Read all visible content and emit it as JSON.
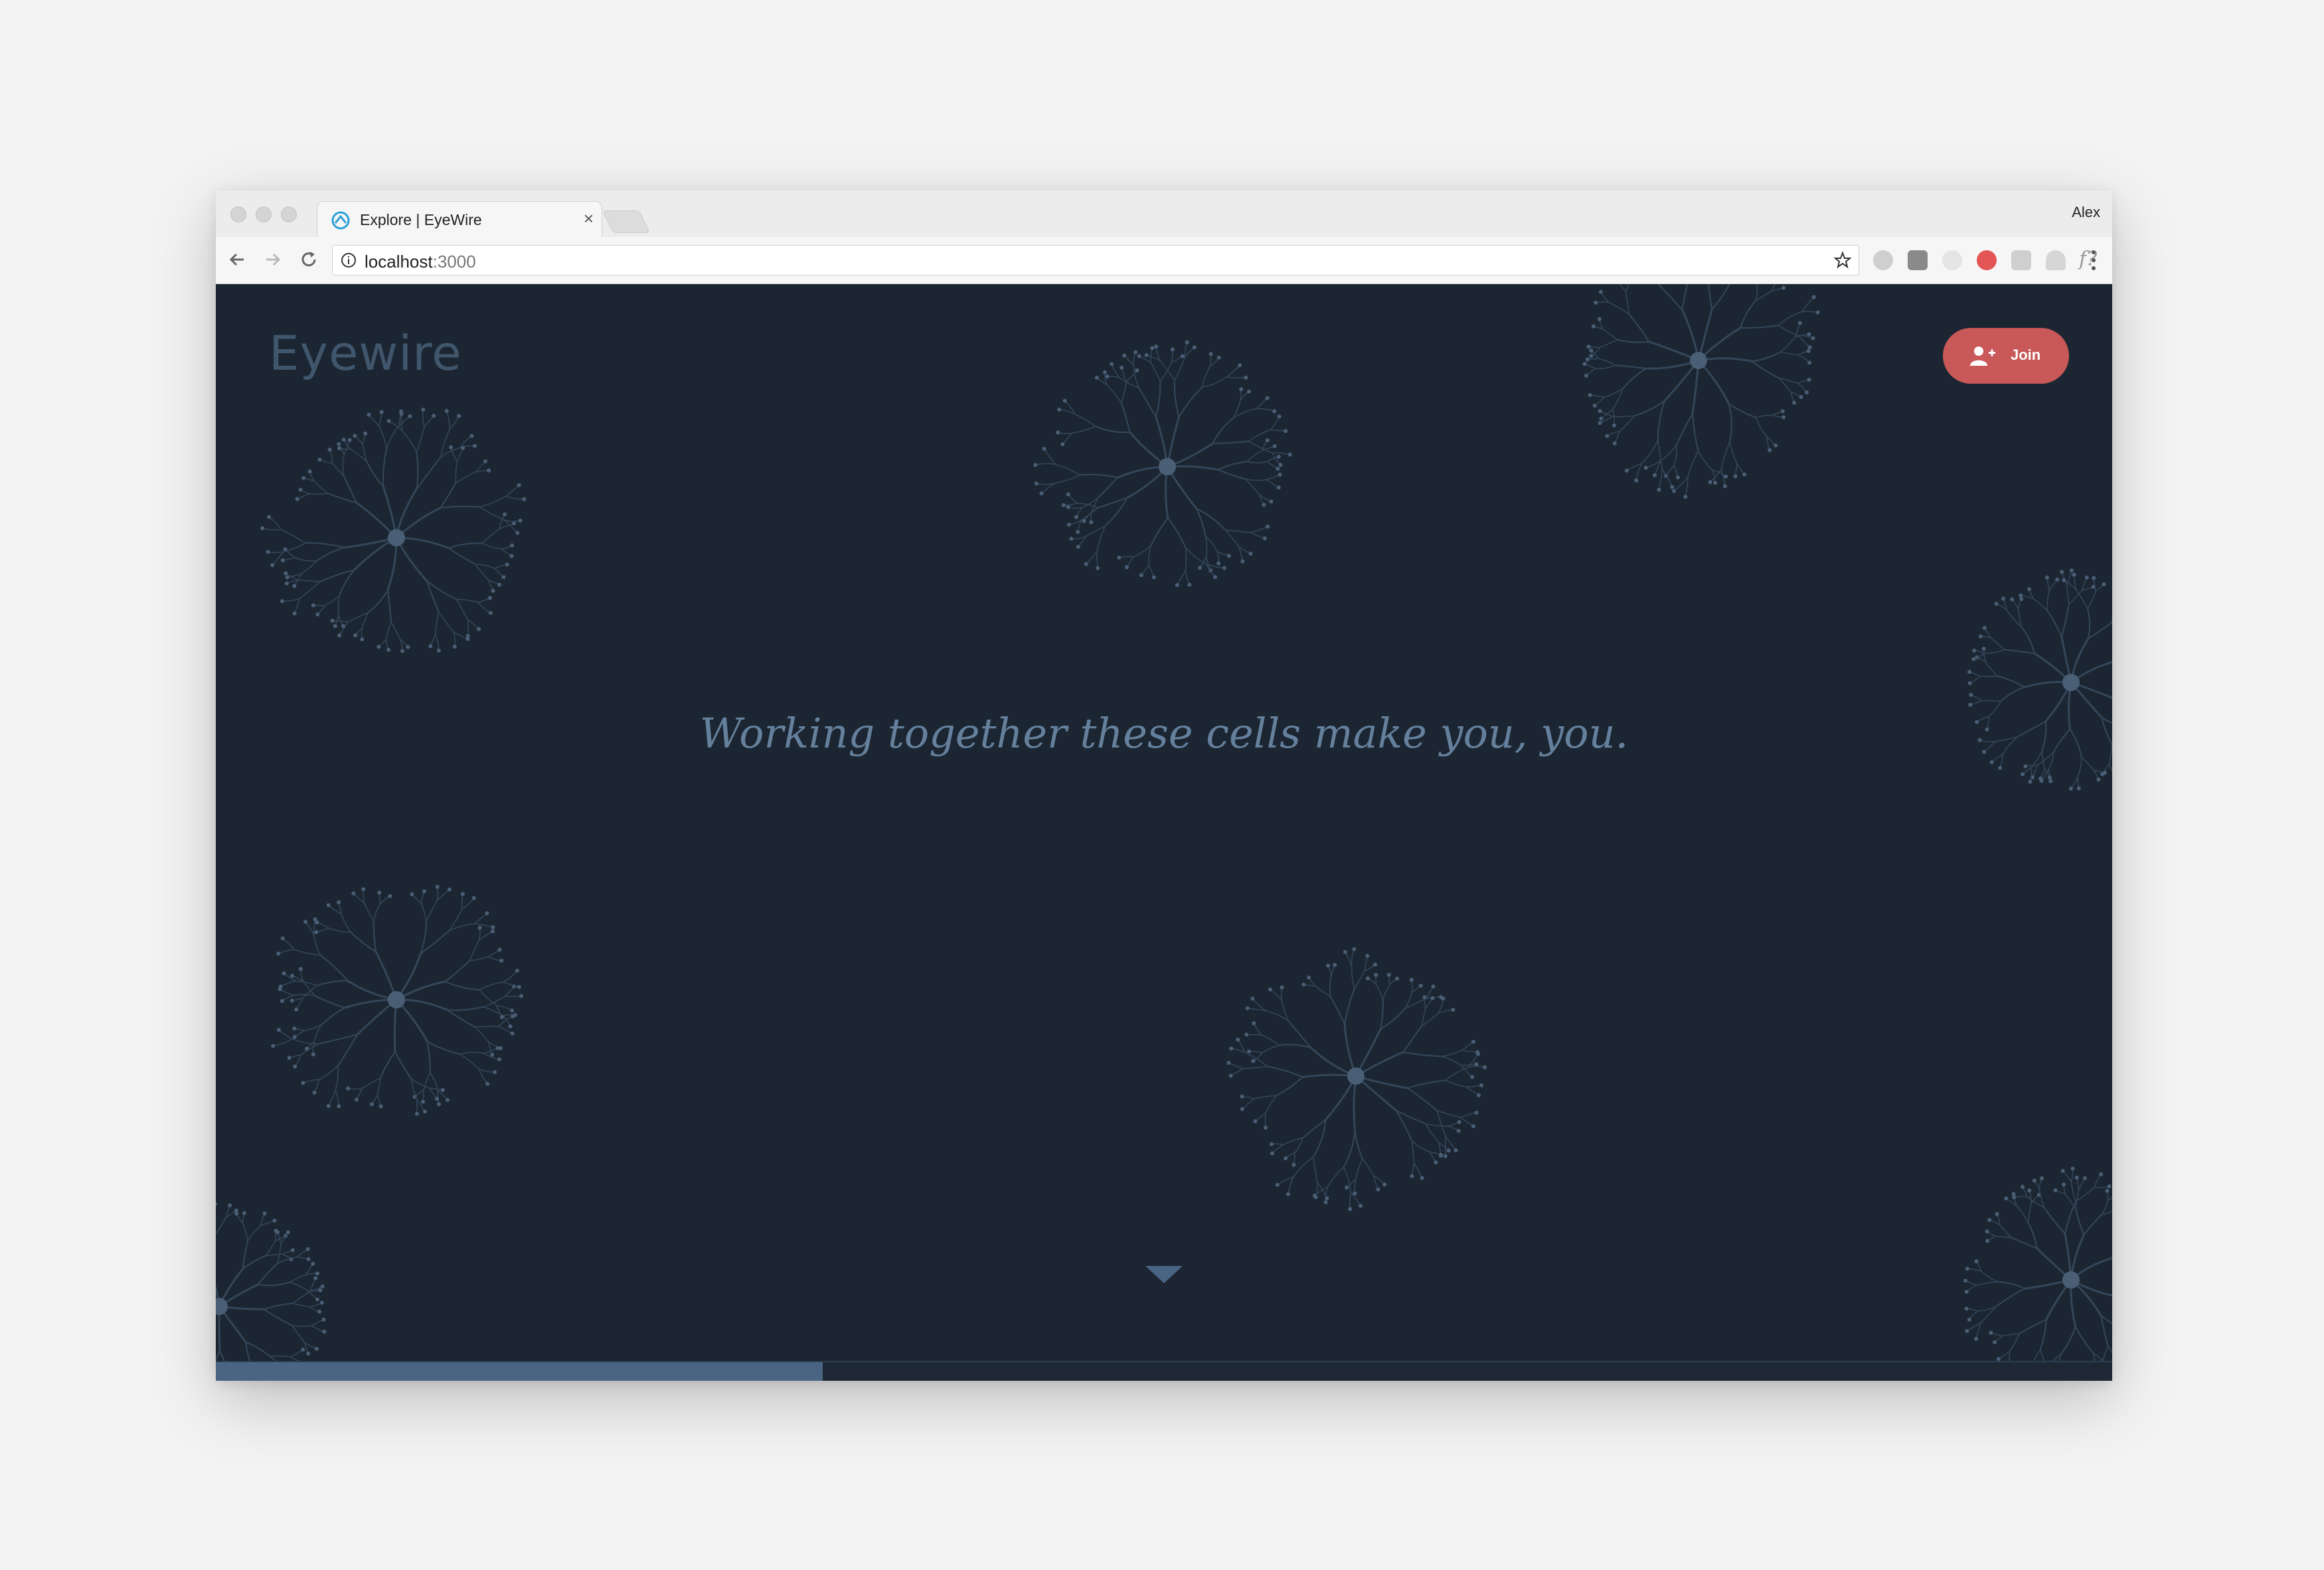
{
  "browser": {
    "tab_title": "Explore | EyeWire",
    "tab_close": "×",
    "profile_name": "Alex",
    "url_host": "localhost",
    "url_port": ":3000",
    "extension_f_label": "f?"
  },
  "page": {
    "logo": "Eyewire",
    "join_label": "Join",
    "tagline": "Working together these cells make you, you.",
    "progress_fraction": 0.32
  },
  "colors": {
    "background": "#1c2632",
    "neuron_line": "#34475a",
    "neuron_soma": "#4a5f76",
    "accent_join": "#c95858",
    "progress": "#4a6583"
  },
  "icons": [
    "favicon-icon",
    "back-icon",
    "forward-icon",
    "reload-icon",
    "info-icon",
    "star-icon",
    "adblock-icon",
    "pocket-icon",
    "link-icon",
    "opera-icon",
    "grammarly-icon",
    "drive-icon",
    "font-icon",
    "screenshot-icon",
    "pinterest-icon",
    "json-icon",
    "vue-icon",
    "chat-icon",
    "menu-icon",
    "add-user-icon",
    "scroll-down-icon"
  ]
}
